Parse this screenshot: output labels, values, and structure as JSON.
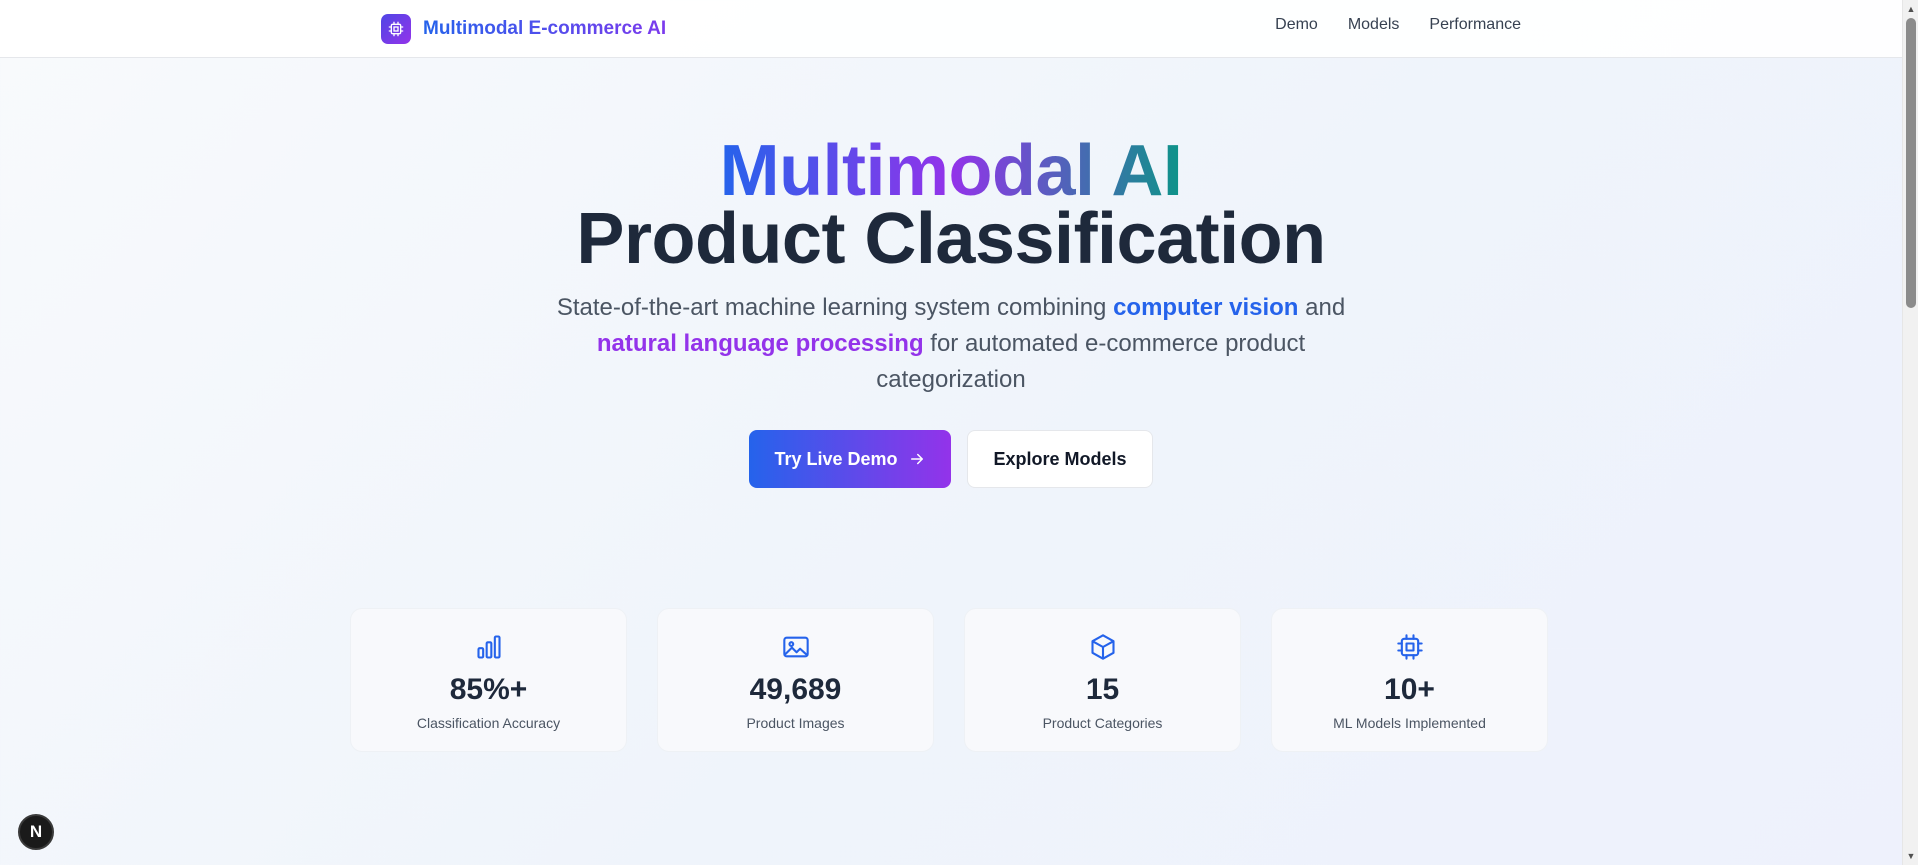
{
  "header": {
    "brand_name": "Multimodal E-commerce AI",
    "logo_icon": "chip-icon",
    "nav": [
      {
        "label": "Demo"
      },
      {
        "label": "Models"
      },
      {
        "label": "Performance"
      }
    ]
  },
  "hero": {
    "title_gradient": "Multimodal AI",
    "title_main": "Product Classification",
    "subtitle": {
      "part1": "State-of-the-art machine learning system combining ",
      "highlight1": "computer vision",
      "part2": " and ",
      "highlight2": "natural language processing",
      "part3": " for automated e-commerce product categorization"
    },
    "primary_button": "Try Live Demo",
    "primary_button_icon": "arrow-right-icon",
    "secondary_button": "Explore Models"
  },
  "stats": [
    {
      "icon": "bar-chart-icon",
      "value": "85%+",
      "label": "Classification Accuracy"
    },
    {
      "icon": "image-icon",
      "value": "49,689",
      "label": "Product Images"
    },
    {
      "icon": "package-icon",
      "value": "15",
      "label": "Product Categories"
    },
    {
      "icon": "chip-icon",
      "value": "10+",
      "label": "ML Models Implemented"
    }
  ],
  "badge": {
    "label": "N"
  },
  "colors": {
    "accent_blue": "#2563eb",
    "accent_purple": "#9333ea",
    "accent_teal": "#0d9488",
    "text_dark": "#1e293b"
  }
}
